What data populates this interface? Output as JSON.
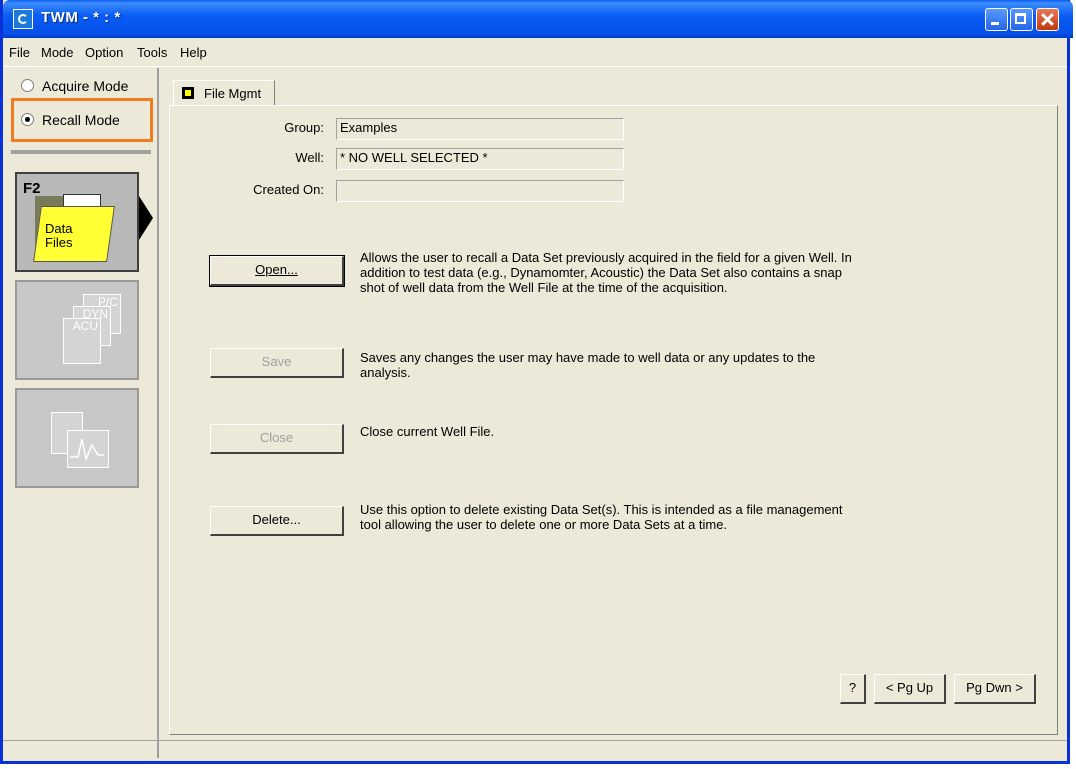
{
  "window": {
    "title": "TWM  -  * : *"
  },
  "menu": [
    "File",
    "Mode",
    "Option",
    "Tools",
    "Help"
  ],
  "modes": {
    "acquire": "Acquire Mode",
    "recall": "Recall Mode",
    "selected": "recall"
  },
  "sidebar": {
    "f2_key": "F2",
    "data_files_label_1": "Data",
    "data_files_label_2": "Files",
    "doc_labels": [
      "P/C",
      "DYN",
      "ACU"
    ]
  },
  "tab": {
    "label": "File Mgmt"
  },
  "fields": {
    "group_label": "Group:",
    "group_value": "Examples",
    "well_label": "Well:",
    "well_value": "* NO WELL SELECTED *",
    "created_label": "Created On:",
    "created_value": ""
  },
  "actions": [
    {
      "label": "Open...",
      "enabled": true,
      "description": "Allows the user to recall a Data Set previously acquired in the field for a given Well.  In addition to test data (e.g.,  Dynamomter, Acoustic) the Data Set also contains a snap shot of well data from the Well File at the time of the acquisition."
    },
    {
      "label": "Save",
      "enabled": false,
      "description": "Saves any changes the user may have made to well data or any updates to the analysis."
    },
    {
      "label": "Close",
      "enabled": false,
      "description": "Close current Well File."
    },
    {
      "label": "Delete...",
      "enabled": true,
      "description": "Use this option to delete existing Data Set(s).  This is intended as a file management tool allowing the user to delete one or more Data Sets at a time."
    }
  ],
  "footer": {
    "help": "?",
    "pgup": "< Pg Up",
    "pgdn": "Pg Dwn >"
  },
  "colors": {
    "titlebar": "#0a5ef5",
    "highlight": "#f07c22",
    "folder": "#ffff33"
  }
}
